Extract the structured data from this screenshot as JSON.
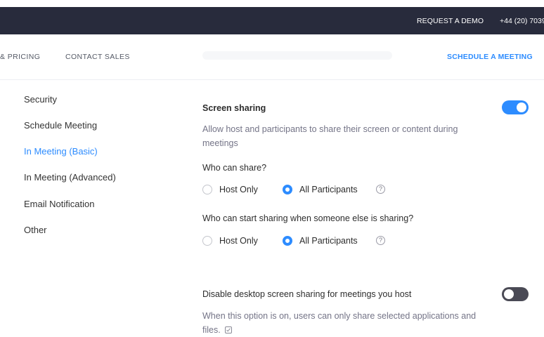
{
  "topbar": {
    "request_demo": "REQUEST A DEMO",
    "phone": "+44 (20) 7039"
  },
  "nav": {
    "pricing": "& PRICING",
    "contact_sales": "CONTACT SALES",
    "schedule_meeting": "SCHEDULE A MEETING"
  },
  "sidebar": {
    "items": [
      {
        "label": "Security",
        "active": false
      },
      {
        "label": "Schedule Meeting",
        "active": false
      },
      {
        "label": "In Meeting (Basic)",
        "active": true
      },
      {
        "label": "In Meeting (Advanced)",
        "active": false
      },
      {
        "label": "Email Notification",
        "active": false
      },
      {
        "label": "Other",
        "active": false
      }
    ]
  },
  "screen_sharing": {
    "title": "Screen sharing",
    "description": "Allow host and participants to share their screen or content during meetings",
    "enabled": true,
    "who_can_share": {
      "question": "Who can share?",
      "options": [
        "Host Only",
        "All Participants"
      ],
      "selected": "All Participants"
    },
    "who_can_start": {
      "question": "Who can start sharing when someone else is sharing?",
      "options": [
        "Host Only",
        "All Participants"
      ],
      "selected": "All Participants"
    },
    "help_glyph": "?"
  },
  "disable_desktop": {
    "title": "Disable desktop screen sharing for meetings you host",
    "description": "When this option is on, users can only share selected applications and files.",
    "enabled": false
  },
  "colors": {
    "accent": "#2d8cff",
    "topbar": "#282b3c",
    "toggle_off": "#4a4a55"
  }
}
